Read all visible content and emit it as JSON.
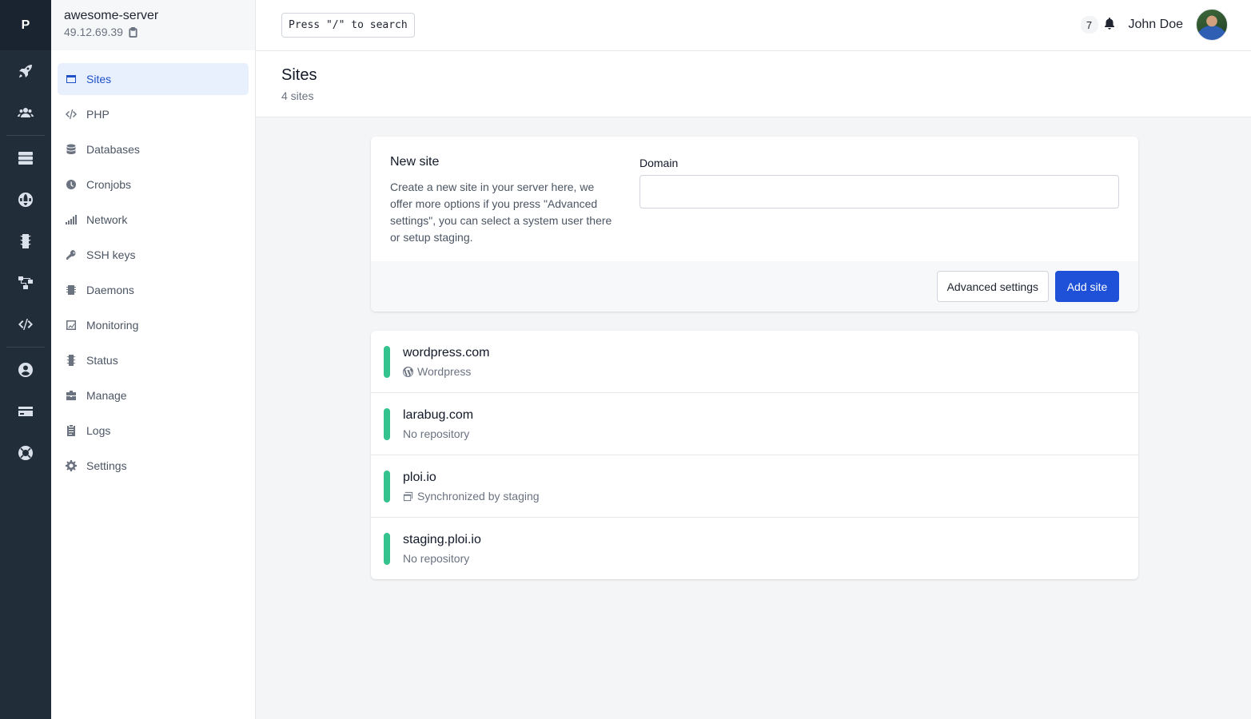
{
  "rail": {
    "logo": "P",
    "icons": [
      "rocket-icon",
      "users-icon",
      "servers-icon",
      "globe-icon",
      "traffic-light-icon",
      "network-tree-icon",
      "code-icon",
      "user-circle-icon",
      "credit-card-icon",
      "lifebuoy-icon"
    ]
  },
  "server": {
    "name": "awesome-server",
    "ip": "49.12.69.39"
  },
  "sidebar": {
    "items": [
      {
        "label": "Sites",
        "icon": "browser-window-icon",
        "active": true
      },
      {
        "label": "PHP",
        "icon": "code-icon"
      },
      {
        "label": "Databases",
        "icon": "database-icon"
      },
      {
        "label": "Cronjobs",
        "icon": "clock-icon"
      },
      {
        "label": "Network",
        "icon": "signal-icon"
      },
      {
        "label": "SSH keys",
        "icon": "key-icon"
      },
      {
        "label": "Daemons",
        "icon": "chip-icon"
      },
      {
        "label": "Monitoring",
        "icon": "monitor-chart-icon"
      },
      {
        "label": "Status",
        "icon": "traffic-light-icon"
      },
      {
        "label": "Manage",
        "icon": "toolbox-icon"
      },
      {
        "label": "Logs",
        "icon": "clipboard-icon"
      },
      {
        "label": "Settings",
        "icon": "gear-icon"
      }
    ]
  },
  "topbar": {
    "search_label": "Press \"/\" to search",
    "notification_count": "7",
    "user_name": "John Doe"
  },
  "header": {
    "title": "Sites",
    "subtitle": "4 sites"
  },
  "new_site": {
    "title": "New site",
    "description": "Create a new site in your server here, we offer more options if you press \"Advanced settings\", you can select a system user there or setup staging.",
    "domain_label": "Domain",
    "domain_value": "",
    "advanced_button": "Advanced settings",
    "add_button": "Add site"
  },
  "sites": [
    {
      "name": "wordpress.com",
      "meta": "Wordpress",
      "meta_icon": "wordpress-icon",
      "status_color": "#34c38f"
    },
    {
      "name": "larabug.com",
      "meta": "No repository",
      "meta_icon": "",
      "status_color": "#34c38f"
    },
    {
      "name": "ploi.io",
      "meta": "Synchronized by staging",
      "meta_icon": "windows-stack-icon",
      "status_color": "#34c38f"
    },
    {
      "name": "staging.ploi.io",
      "meta": "No repository",
      "meta_icon": "",
      "status_color": "#34c38f"
    }
  ],
  "colors": {
    "rail_bg": "#222d3a",
    "accent": "#1e50d8",
    "status_ok": "#34c38f"
  }
}
